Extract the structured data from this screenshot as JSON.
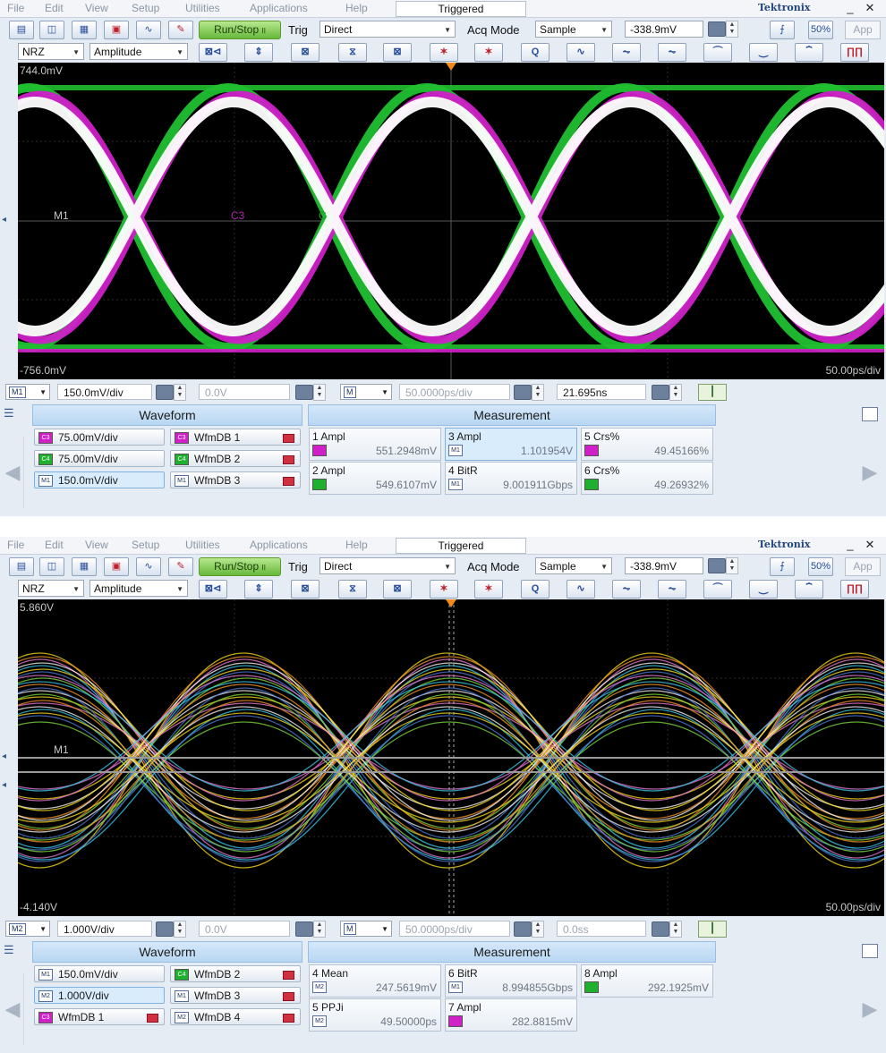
{
  "menu": [
    "File",
    "Edit",
    "View",
    "Setup",
    "Utilities",
    "Applications",
    "Help"
  ],
  "scopes": [
    {
      "status": "Triggered",
      "brand": "Tektronix",
      "toolbar": {
        "run_stop": "Run/Stop",
        "trig_label": "Trig",
        "trig_source": "Direct",
        "acq_mode_label": "Acq Mode",
        "acq_mode": "Sample",
        "trig_level": "-338.9mV",
        "app": "App",
        "pattern": "NRZ",
        "measure_type": "Amplitude"
      },
      "screen": {
        "top_label": "744.0mV",
        "bottom_label": "-756.0mV",
        "timebase_label": "50.00ps/div",
        "marker_m1": "M1",
        "marker_c3": "C3",
        "marker_c": "C"
      },
      "controls": {
        "source": "M1",
        "scale": "150.0mV/div",
        "offset": "0.0V",
        "main": "M",
        "horiz_scale": "50.0000ps/div",
        "position": "21.695ns"
      },
      "waveform_header": "Waveform",
      "measurement_header": "Measurement",
      "waveforms": [
        {
          "tag": "C3",
          "label": "75.00mV/div",
          "color": "magenta",
          "selected": false
        },
        {
          "tag": "C3",
          "label": "WfmDB 1",
          "color": "magenta",
          "selected": false
        },
        {
          "tag": "C4",
          "label": "75.00mV/div",
          "color": "green",
          "selected": false
        },
        {
          "tag": "C4",
          "label": "WfmDB 2",
          "color": "green",
          "selected": false
        },
        {
          "tag": "M1",
          "label": "150.0mV/div",
          "color": "white",
          "selected": true
        },
        {
          "tag": "M1",
          "label": "WfmDB 3",
          "color": "white",
          "selected": false
        }
      ],
      "measurements": [
        {
          "name": "1 Ampl",
          "value": "551.2948mV",
          "src": "C3",
          "color": "magenta",
          "selected": false
        },
        {
          "name": "3 Ampl",
          "value": "1.101954V",
          "src": "M1",
          "color": "white",
          "selected": true
        },
        {
          "name": "5 Crs%",
          "value": "49.45166%",
          "src": "C3",
          "color": "magenta",
          "selected": false
        },
        {
          "name": "2 Ampl",
          "value": "549.6107mV",
          "src": "C4",
          "color": "green",
          "selected": false
        },
        {
          "name": "4 BitR",
          "value": "9.001911Gbps",
          "src": "M1",
          "color": "white",
          "selected": false
        },
        {
          "name": "6 Crs%",
          "value": "49.26932%",
          "src": "C4",
          "color": "green",
          "selected": false
        }
      ]
    },
    {
      "status": "Triggered",
      "brand": "Tektronix",
      "toolbar": {
        "run_stop": "Run/Stop",
        "trig_label": "Trig",
        "trig_source": "Direct",
        "acq_mode_label": "Acq Mode",
        "acq_mode": "Sample",
        "trig_level": "-338.9mV",
        "app": "App",
        "pattern": "NRZ",
        "measure_type": "Amplitude"
      },
      "screen": {
        "top_label": "5.860V",
        "bottom_label": "-4.140V",
        "timebase_label": "50.00ps/div",
        "marker_m1": "M1"
      },
      "controls": {
        "source": "M2",
        "scale": "1.000V/div",
        "offset": "0.0V",
        "main": "M",
        "horiz_scale": "50.0000ps/div",
        "position": "0.0ss"
      },
      "waveform_header": "Waveform",
      "measurement_header": "Measurement",
      "waveforms": [
        {
          "tag": "M1",
          "label": "150.0mV/div",
          "color": "white",
          "selected": false
        },
        {
          "tag": "C4",
          "label": "WfmDB 2",
          "color": "green",
          "selected": false
        },
        {
          "tag": "M2",
          "label": "1.000V/div",
          "color": "white",
          "selected": true
        },
        {
          "tag": "M1",
          "label": "WfmDB 3",
          "color": "white",
          "selected": false
        },
        {
          "tag": "C3",
          "label": "WfmDB 1",
          "color": "magenta",
          "selected": false
        },
        {
          "tag": "M2",
          "label": "WfmDB 4",
          "color": "white",
          "selected": false
        }
      ],
      "measurements": [
        {
          "name": "4 Mean",
          "value": "247.5619mV",
          "src": "M2",
          "color": "white",
          "selected": false
        },
        {
          "name": "6 BitR",
          "value": "8.994855Gbps",
          "src": "M1",
          "color": "white",
          "selected": false
        },
        {
          "name": "8 Ampl",
          "value": "292.1925mV",
          "src": "C4",
          "color": "green",
          "selected": false
        },
        {
          "name": "5 PPJi",
          "value": "49.50000ps",
          "src": "M2",
          "color": "white",
          "selected": false
        },
        {
          "name": "7 Ampl",
          "value": "282.8815mV",
          "src": "C3",
          "color": "magenta",
          "selected": false
        }
      ]
    }
  ],
  "colors": {
    "magenta": "#d020c8",
    "green": "#20c030",
    "accent": "#b8d6f2",
    "screen_bg": "#000000"
  }
}
